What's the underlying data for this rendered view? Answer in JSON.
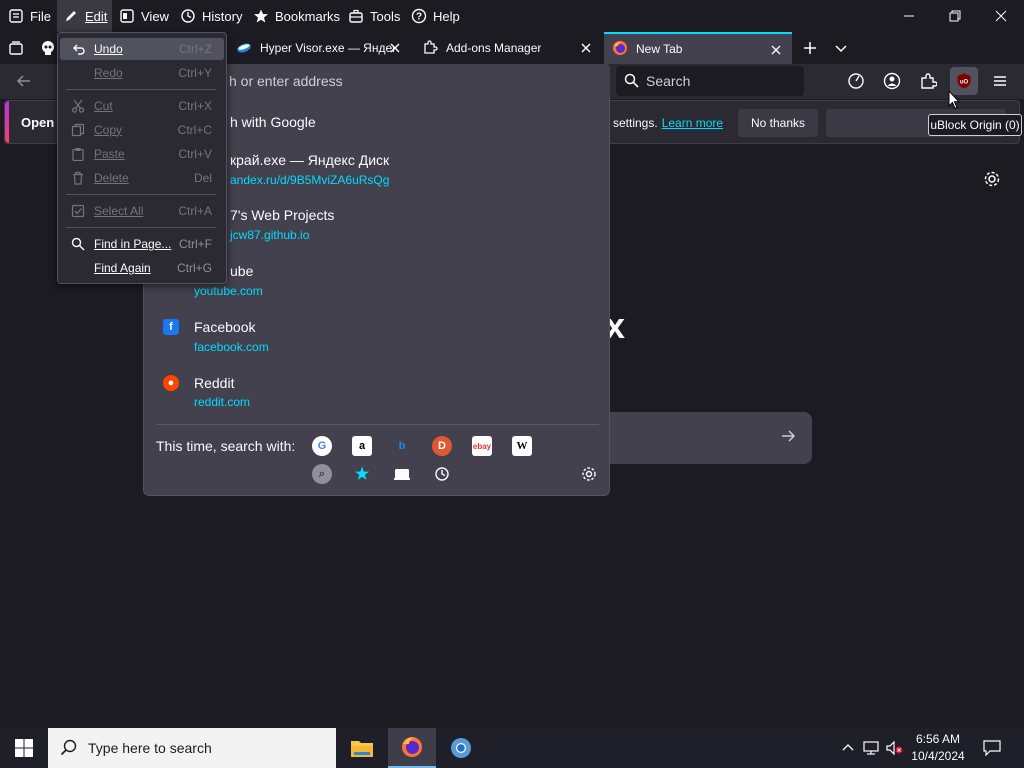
{
  "menubar": {
    "items": [
      {
        "label": "File",
        "icon": "file-menu-icon"
      },
      {
        "label": "Edit",
        "icon": "pencil-icon"
      },
      {
        "label": "View",
        "icon": "view-icon"
      },
      {
        "label": "History",
        "icon": "clock-icon"
      },
      {
        "label": "Bookmarks",
        "icon": "star-icon"
      },
      {
        "label": "Tools",
        "icon": "briefcase-icon"
      },
      {
        "label": "Help",
        "icon": "help-icon"
      }
    ]
  },
  "tabs": [
    {
      "label": "Hyper Visor.exe — Яндекс"
    },
    {
      "label": "Add-ons Manager"
    },
    {
      "label": "New Tab"
    }
  ],
  "urlbar": {
    "placeholder": "h or enter address"
  },
  "searchbar": {
    "placeholder": "Search"
  },
  "notification": {
    "open_label": "Open",
    "message": "settings.",
    "learn_more": "Learn more",
    "no_thanks": "No thanks"
  },
  "tooltip": "uBlock Origin (0)",
  "edit_menu": {
    "items": [
      {
        "label": "Undo",
        "shortcut": "Ctrl+Z",
        "enabled": true
      },
      {
        "label": "Redo",
        "shortcut": "Ctrl+Y",
        "enabled": false
      },
      {
        "label": "Cut",
        "shortcut": "Ctrl+X",
        "enabled": false
      },
      {
        "label": "Copy",
        "shortcut": "Ctrl+C",
        "enabled": false
      },
      {
        "label": "Paste",
        "shortcut": "Ctrl+V",
        "enabled": false
      },
      {
        "label": "Delete",
        "shortcut": "Del",
        "enabled": false
      },
      {
        "label": "Select All",
        "shortcut": "Ctrl+A",
        "enabled": false
      },
      {
        "label": "Find in Page...",
        "shortcut": "Ctrl+F",
        "enabled": true
      },
      {
        "label": "Find Again",
        "shortcut": "Ctrl+G",
        "enabled": true
      }
    ]
  },
  "dropdown": {
    "search_row": "h with Google",
    "results": [
      {
        "title": "крaй.exe — Яндекс Диск",
        "url": "andex.ru/d/9B5MviZA6uRsQg"
      },
      {
        "title": "7's Web Projects",
        "url": "jcw87.github.io"
      },
      {
        "title": "ube",
        "url": "youtube.com"
      },
      {
        "title": "Facebook",
        "url": "facebook.com"
      },
      {
        "title": "Reddit",
        "url": "reddit.com"
      }
    ],
    "oneoff_label": "This time, search with:"
  },
  "taskbar": {
    "search_placeholder": "Type here to search",
    "time": "6:56 AM",
    "date": "10/4/2024"
  }
}
